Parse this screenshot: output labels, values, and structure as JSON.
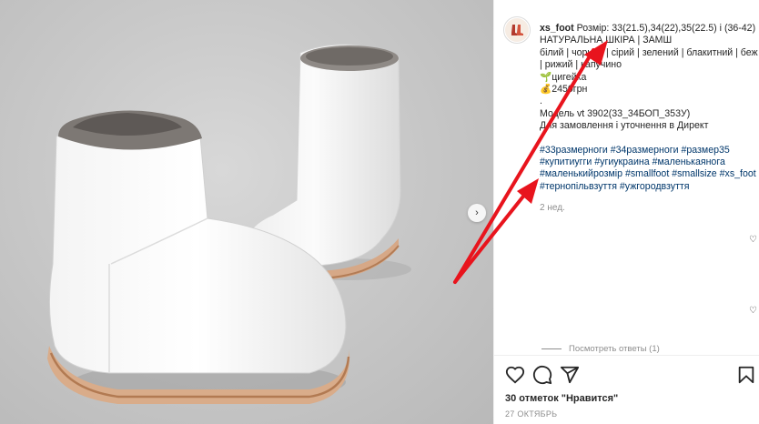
{
  "post": {
    "username": "xs_foot",
    "caption_lines": [
      "Розмір: 33(21.5),34(22),35(22.5) і (36-42)",
      "НАТУРАЛЬНА ШКІРА | ЗАМШ",
      "білий | чорний | сірий | зелений | блакитний | беж",
      "| рижий | капучино",
      "🌱цигейка",
      "💰2450грн",
      ".",
      "Модель vt 3902(33_34БОП_353У)",
      "Для замовлення і уточнення в Директ"
    ],
    "hashtags": [
      [
        "#33размерноги",
        "#34размерноги",
        "#размер35"
      ],
      [
        "#купитиугги",
        "#угиукраина",
        "#маленькаянога"
      ],
      [
        "#маленькийрозмір",
        "#smallfoot",
        "#smallsize",
        "#xs_foot"
      ],
      [
        "#тернопільвзуття",
        "#ужгородвзуття"
      ]
    ],
    "time_ago": "2 нед.",
    "comments_label": "Посмотреть ответы (1)",
    "likes": "30 отметок \"Нравится\"",
    "date": "27 ОКТЯБРЬ"
  },
  "icons": {
    "heart": "heart-icon",
    "comment": "comment-icon",
    "share": "share-icon",
    "bookmark": "bookmark-icon",
    "next": "chevron-right-icon"
  },
  "colors": {
    "annotation_arrow": "#e8141d",
    "hashtag": "#00376b",
    "muted": "#8e8e8e"
  }
}
